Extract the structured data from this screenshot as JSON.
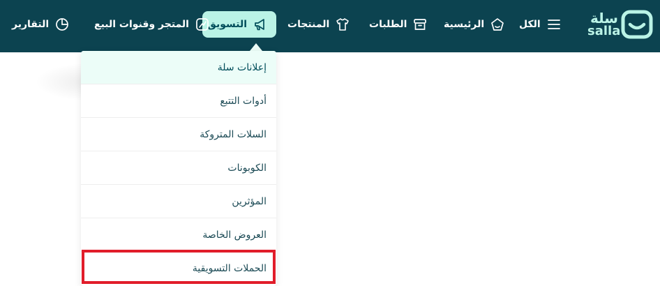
{
  "brand": {
    "name_ar": "سلة",
    "name_en": "salla"
  },
  "nav": {
    "all": "الكل",
    "home": "الرئيسية",
    "orders": "الطلبات",
    "products": "المنتجات",
    "marketing": "التسويق",
    "store_channels": "المتجر وقنوات البيع",
    "reports": "التقارير"
  },
  "marketing_menu": {
    "items": [
      "إعلانات سلة",
      "أدوات التتبع",
      "السلات المتروكة",
      "الكوبونات",
      "المؤثرين",
      "العروض الخاصة",
      "الحملات التسويقية"
    ]
  },
  "colors": {
    "topbar": "#0c4350",
    "active_bg": "#baf3e6",
    "highlight": "#e11d2a"
  }
}
